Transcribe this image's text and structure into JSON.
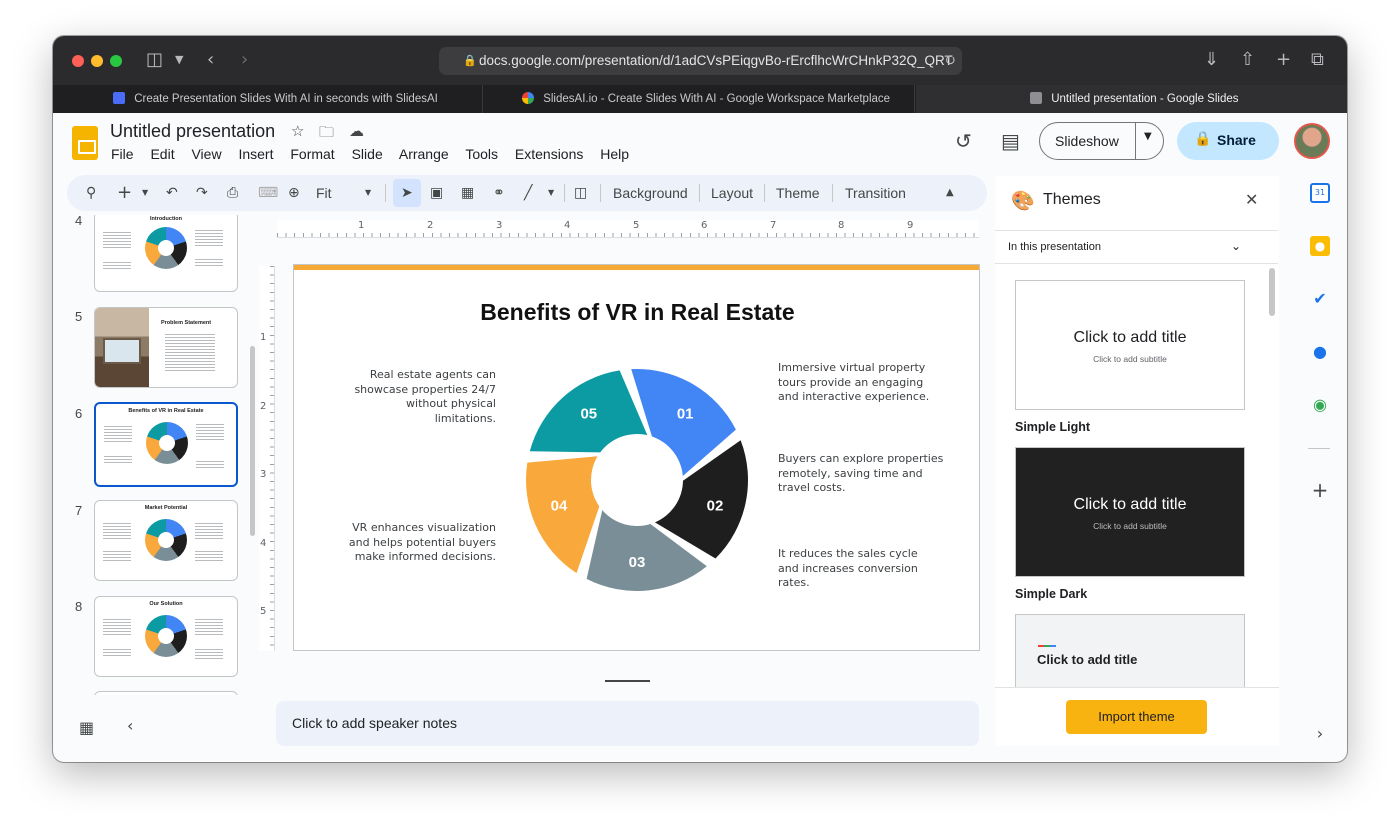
{
  "browser": {
    "url": "docs.google.com/presentation/d/1adCVsPEiqgvBo-rErcflhcWrCHnkP32Q_QRT",
    "tabs": [
      {
        "label": "Create Presentation Slides With AI in seconds with SlidesAI",
        "active": false
      },
      {
        "label": "SlidesAI.io - Create Slides With AI - Google Workspace Marketplace",
        "active": false
      },
      {
        "label": "Untitled presentation - Google Slides",
        "active": true
      }
    ]
  },
  "app": {
    "title": "Untitled presentation",
    "menu": [
      "File",
      "Edit",
      "View",
      "Insert",
      "Format",
      "Slide",
      "Arrange",
      "Tools",
      "Extensions",
      "Help"
    ],
    "slideshow_label": "Slideshow",
    "share_label": "Share"
  },
  "toolbar": {
    "zoom_value": "Fit",
    "buttons": [
      "Background",
      "Layout",
      "Theme",
      "Transition"
    ]
  },
  "filmstrip": {
    "slides": [
      {
        "number": "4",
        "title": "Introduction"
      },
      {
        "number": "5",
        "title": "Problem Statement"
      },
      {
        "number": "6",
        "title": "Benefits of VR in Real Estate",
        "selected": true
      },
      {
        "number": "7",
        "title": "Market Potential"
      },
      {
        "number": "8",
        "title": "Our Solution"
      }
    ]
  },
  "ruler": {
    "horizontal": [
      "1",
      "2",
      "3",
      "4",
      "5",
      "6",
      "7",
      "8",
      "9"
    ],
    "vertical": [
      "1",
      "2",
      "3",
      "4",
      "5"
    ]
  },
  "slide": {
    "title": "Benefits of VR in Real Estate",
    "accent_color": "#f6a935",
    "segments": [
      {
        "label": "01",
        "color": "#4285f4"
      },
      {
        "label": "02",
        "color": "#1e1e1e"
      },
      {
        "label": "03",
        "color": "#7a8e98"
      },
      {
        "label": "04",
        "color": "#f9a83b"
      },
      {
        "label": "05",
        "color": "#0d9ba3"
      }
    ],
    "text_left_1": "Real estate agents can showcase properties 24/7 without physical limitations.",
    "text_left_2": "VR enhances visualization and helps potential buyers make informed decisions.",
    "text_right_1": "Immersive virtual property tours provide an engaging and interactive experience.",
    "text_right_2": "Buyers can explore properties remotely, saving time and travel costs.",
    "text_right_3": "It reduces the sales cycle and increases conversion rates."
  },
  "notes": {
    "placeholder": "Click to add speaker notes"
  },
  "themes_panel": {
    "title": "Themes",
    "filter": "In this presentation",
    "themes": [
      {
        "name": "Simple Light",
        "card_title": "Click to add title",
        "card_subtitle": "Click to add subtitle"
      },
      {
        "name": "Simple Dark",
        "card_title": "Click to add title",
        "card_subtitle": "Click to add subtitle"
      },
      {
        "name": "",
        "card_title": "Click to add title",
        "card_subtitle": ""
      }
    ],
    "import_label": "Import theme"
  },
  "side_rail": {
    "calendar_day": "31"
  }
}
